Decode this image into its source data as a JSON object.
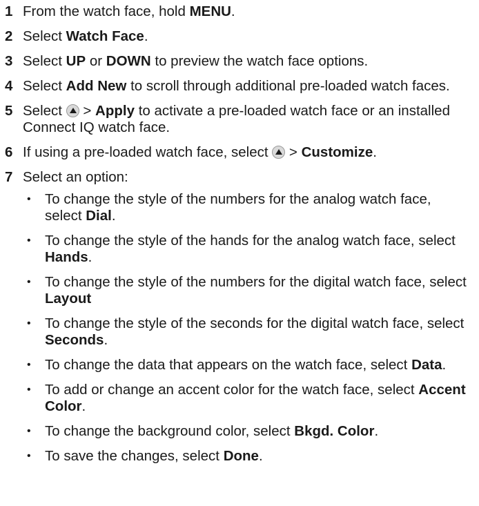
{
  "steps": [
    {
      "n": "1",
      "a": "From the watch face, hold ",
      "b": "MENU",
      "c": "."
    },
    {
      "n": "2",
      "a": "Select ",
      "b": "Watch Face",
      "c": "."
    },
    {
      "n": "3",
      "a": "Select ",
      "b": "UP",
      "c": " or ",
      "d": "DOWN",
      "e": " to preview the watch face options."
    },
    {
      "n": "4",
      "a": "Select ",
      "b": "Add New",
      "c": " to scroll through additional pre-loaded watch faces."
    },
    {
      "n": "5",
      "a": "Select ",
      "icon": "up-arrow-button-icon",
      "b": " > ",
      "c": "Apply",
      "d": " to activate a pre-loaded watch face or an installed Connect IQ watch face."
    },
    {
      "n": "6",
      "a": "If using a pre-loaded watch face, select ",
      "icon": "up-arrow-button-icon",
      "b": " > ",
      "c": "Customize",
      "d": "."
    },
    {
      "n": "7",
      "a": "Select an option:"
    }
  ],
  "options": [
    {
      "a": "To change the style of the numbers for the analog watch face, select ",
      "b": "Dial",
      "c": "."
    },
    {
      "a": "To change the style of the hands for the analog watch face, select ",
      "b": "Hands",
      "c": "."
    },
    {
      "a": "To change the style of the numbers for the digital watch face, select ",
      "b": "Layout",
      "c": ""
    },
    {
      "a": "To change the style of the seconds for the digital watch face, select ",
      "b": "Seconds",
      "c": "."
    },
    {
      "a": "To change the data that appears on the watch face, select ",
      "b": "Data",
      "c": "."
    },
    {
      "a": "To add or change an accent color for the watch face, select ",
      "b": "Accent Color",
      "c": "."
    },
    {
      "a": "To change the background color, select ",
      "b": "Bkgd. Color",
      "c": "."
    },
    {
      "a": "To save the changes, select ",
      "b": "Done",
      "c": "."
    }
  ],
  "bullet": "•"
}
